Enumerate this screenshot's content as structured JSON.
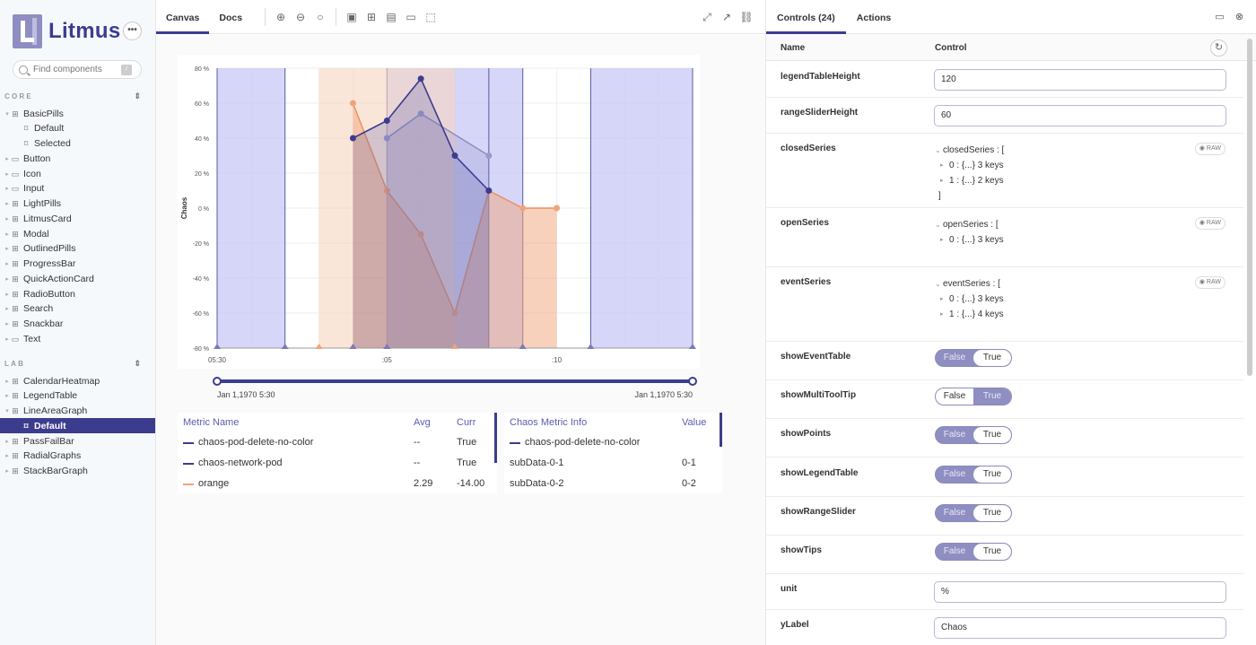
{
  "app": {
    "name": "Litmus",
    "menu": "•••"
  },
  "search": {
    "placeholder": "Find components",
    "shortcut": "/"
  },
  "sidebar": {
    "core_label": "CORE",
    "lab_label": "LAB",
    "collapse": "⇕",
    "core_items": [
      {
        "label": "BasicPills",
        "icon": "component-icon",
        "expanded": true,
        "type": "component"
      },
      {
        "label": "Default",
        "type": "story"
      },
      {
        "label": "Selected",
        "type": "story"
      },
      {
        "label": "Button",
        "type": "folder"
      },
      {
        "label": "Icon",
        "type": "folder"
      },
      {
        "label": "Input",
        "type": "folder"
      },
      {
        "label": "LightPills",
        "type": "component"
      },
      {
        "label": "LitmusCard",
        "type": "component"
      },
      {
        "label": "Modal",
        "type": "component"
      },
      {
        "label": "OutlinedPills",
        "type": "component"
      },
      {
        "label": "ProgressBar",
        "type": "component"
      },
      {
        "label": "QuickActionCard",
        "type": "component"
      },
      {
        "label": "RadioButton",
        "type": "component"
      },
      {
        "label": "Search",
        "type": "component"
      },
      {
        "label": "Snackbar",
        "type": "component"
      },
      {
        "label": "Text",
        "type": "folder"
      }
    ],
    "lab_items": [
      {
        "label": "CalendarHeatmap",
        "type": "component"
      },
      {
        "label": "LegendTable",
        "type": "component"
      },
      {
        "label": "LineAreaGraph",
        "type": "component",
        "expanded": true
      },
      {
        "label": "Default",
        "type": "story",
        "selected": true
      },
      {
        "label": "PassFailBar",
        "type": "component"
      },
      {
        "label": "RadialGraphs",
        "type": "component"
      },
      {
        "label": "StackBarGraph",
        "type": "component"
      }
    ]
  },
  "toolbar": {
    "canvas": "Canvas",
    "docs": "Docs"
  },
  "chart_data": {
    "type": "area",
    "ylabel": "Chaos",
    "ylim": [
      -80,
      80
    ],
    "yticks": [
      "80 %",
      "60 %",
      "40 %",
      "20 %",
      "0 %",
      "-20 %",
      "-40 %",
      "-60 %",
      "-80 %"
    ],
    "xticks": [
      "05:30",
      ":05",
      ":10"
    ],
    "range_start": "Jan 1,1970 5:30",
    "range_end": "Jan 1,1970 5:30",
    "colors": {
      "primary": "#3c3c8f",
      "orange": "#f0a479",
      "band": "#c8c8f5"
    },
    "series": [
      {
        "name": "chaos-pod-delete-no-color",
        "x": [
          4,
          5,
          6,
          7,
          8
        ],
        "values": [
          40,
          50,
          74,
          30,
          10
        ]
      },
      {
        "name": "chaos-network-pod",
        "x": [
          5,
          6,
          8
        ],
        "values": [
          40,
          54,
          30
        ]
      },
      {
        "name": "orange",
        "x": [
          4,
          5,
          6,
          7,
          8,
          9,
          10
        ],
        "values": [
          60,
          10,
          -15,
          -60,
          10,
          0,
          0
        ]
      }
    ],
    "legend_left": {
      "headers": [
        "Metric Name",
        "Avg",
        "Curr"
      ],
      "rows": [
        {
          "name": "chaos-pod-delete-no-color",
          "avg": "--",
          "curr": "True"
        },
        {
          "name": "chaos-network-pod",
          "avg": "--",
          "curr": "True"
        },
        {
          "name": "orange",
          "avg": "2.29",
          "curr": "-14.00"
        }
      ]
    },
    "legend_right": {
      "headers": [
        "Chaos Metric Info",
        "Value"
      ],
      "rows": [
        {
          "name": "chaos-pod-delete-no-color",
          "value": ""
        },
        {
          "name": "subData-0-1",
          "value": "0-1"
        },
        {
          "name": "subData-0-2",
          "value": "0-2"
        }
      ]
    }
  },
  "panel": {
    "tab_controls": "Controls (24)",
    "tab_actions": "Actions",
    "col_name": "Name",
    "col_control": "Control",
    "raw": "RAW",
    "legendTableHeight": {
      "label": "legendTableHeight",
      "value": "120"
    },
    "rangeSliderHeight": {
      "label": "rangeSliderHeight",
      "value": "60"
    },
    "closedSeries": {
      "label": "closedSeries",
      "head": "closedSeries : [",
      "items": [
        "0 : {...} 3 keys",
        "1 : {...} 2 keys"
      ],
      "close": "]"
    },
    "openSeries": {
      "label": "openSeries",
      "head": "openSeries : [",
      "items": [
        "0 : {...} 3 keys"
      ],
      "close": "]"
    },
    "eventSeries": {
      "label": "eventSeries",
      "head": "eventSeries : [",
      "items": [
        "0 : {...} 3 keys",
        "1 : {...} 4 keys"
      ],
      "close": "]"
    },
    "false_label": "False",
    "true_label": "True",
    "toggles": [
      {
        "label": "showEventTable",
        "value": true
      },
      {
        "label": "showMultiToolTip",
        "value": false
      },
      {
        "label": "showPoints",
        "value": true
      },
      {
        "label": "showLegendTable",
        "value": true
      },
      {
        "label": "showRangeSlider",
        "value": true
      },
      {
        "label": "showTips",
        "value": true
      }
    ],
    "unit": {
      "label": "unit",
      "value": "%"
    },
    "yLabel": {
      "label": "yLabel",
      "value": "Chaos"
    }
  }
}
